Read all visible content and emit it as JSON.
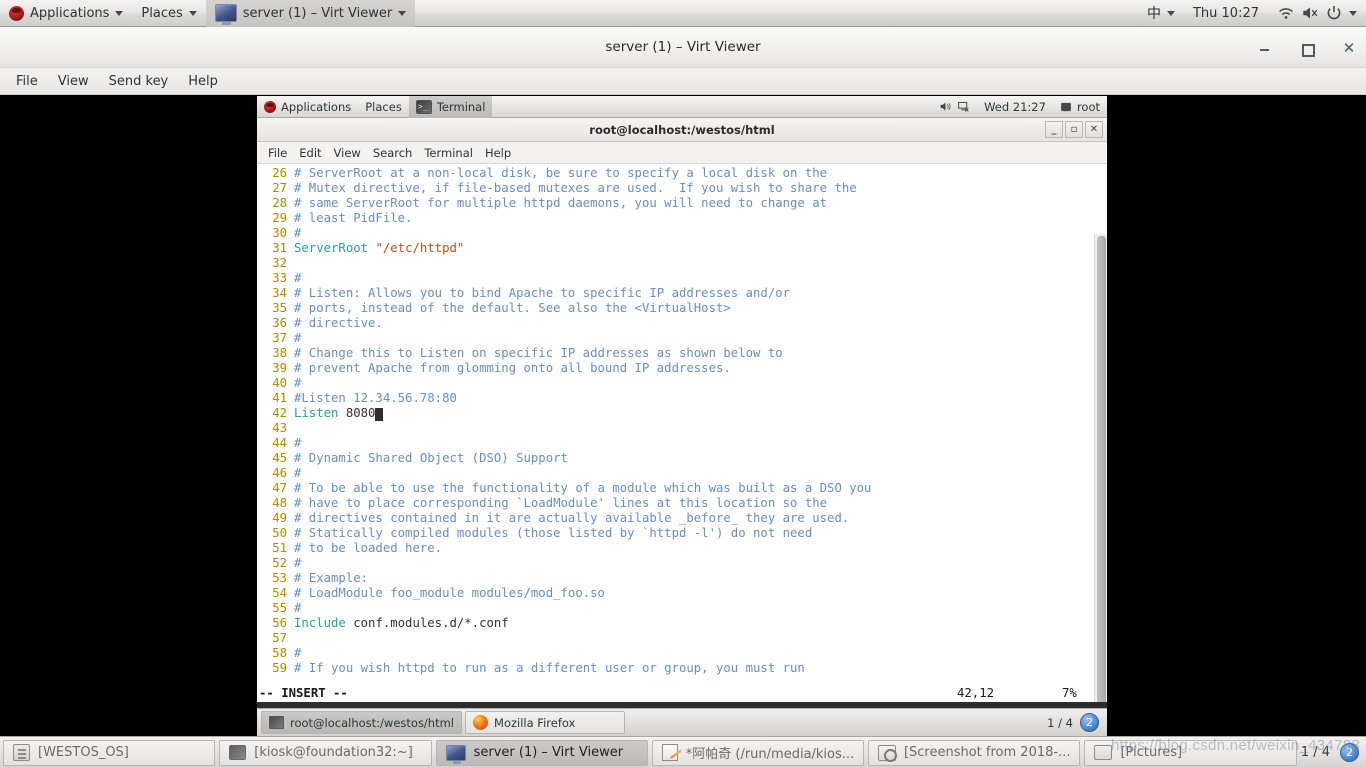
{
  "host_topbar": {
    "applications": "Applications",
    "places": "Places",
    "window_title": "server (1) – Virt Viewer",
    "ime": "中",
    "clock": "Thu 10:27",
    "icons": [
      "redhat-logo",
      "wifi-icon",
      "volume-muted-icon",
      "power-icon",
      "chevron-down-icon"
    ]
  },
  "virt_viewer": {
    "title": "server (1) – Virt Viewer",
    "menus": [
      "File",
      "View",
      "Send key",
      "Help"
    ],
    "window_buttons": [
      "minimize",
      "maximize",
      "close"
    ]
  },
  "guest": {
    "topbar": {
      "applications": "Applications",
      "places": "Places",
      "active_window": "Terminal",
      "clock": "Wed 21:27",
      "user": "root"
    },
    "terminal": {
      "title": "root@localhost:/westos/html",
      "menus": [
        "File",
        "Edit",
        "View",
        "Search",
        "Terminal",
        "Help"
      ],
      "status": {
        "mode": "-- INSERT --",
        "position": "42,12",
        "percent": "7%"
      },
      "lines": [
        {
          "n": "26",
          "cmt": "# ServerRoot at a non-local disk, be sure to specify a local disk on the"
        },
        {
          "n": "27",
          "cmt": "# Mutex directive, if file-based mutexes are used.  If you wish to share the"
        },
        {
          "n": "28",
          "cmt": "# same ServerRoot for multiple httpd daemons, you will need to change at"
        },
        {
          "n": "29",
          "cmt": "# least PidFile."
        },
        {
          "n": "30",
          "cmt": "#"
        },
        {
          "n": "31",
          "dir": "ServerRoot",
          "str": " \"/etc/httpd\""
        },
        {
          "n": "32",
          "cmt": ""
        },
        {
          "n": "33",
          "cmt": "#"
        },
        {
          "n": "34",
          "cmt": "# Listen: Allows you to bind Apache to specific IP addresses and/or"
        },
        {
          "n": "35",
          "cmt": "# ports, instead of the default. See also the <VirtualHost>"
        },
        {
          "n": "36",
          "cmt": "# directive."
        },
        {
          "n": "37",
          "cmt": "#"
        },
        {
          "n": "38",
          "cmt": "# Change this to Listen on specific IP addresses as shown below to"
        },
        {
          "n": "39",
          "cmt": "# prevent Apache from glomming onto all bound IP addresses."
        },
        {
          "n": "40",
          "cmt": "#"
        },
        {
          "n": "41",
          "cmt": "#Listen 12.34.56.78:80"
        },
        {
          "n": "42",
          "dir": "Listen",
          "val": " 8080",
          "cursor": true
        },
        {
          "n": "43",
          "cmt": ""
        },
        {
          "n": "44",
          "cmt": "#"
        },
        {
          "n": "45",
          "cmt": "# Dynamic Shared Object (DSO) Support"
        },
        {
          "n": "46",
          "cmt": "#"
        },
        {
          "n": "47",
          "cmt": "# To be able to use the functionality of a module which was built as a DSO you"
        },
        {
          "n": "48",
          "cmt": "# have to place corresponding `LoadModule' lines at this location so the"
        },
        {
          "n": "49",
          "cmt": "# directives contained in it are actually available _before_ they are used."
        },
        {
          "n": "50",
          "cmt": "# Statically compiled modules (those listed by `httpd -l') do not need"
        },
        {
          "n": "51",
          "cmt": "# to be loaded here."
        },
        {
          "n": "52",
          "cmt": "#"
        },
        {
          "n": "53",
          "cmt": "# Example:"
        },
        {
          "n": "54",
          "cmt": "# LoadModule foo_module modules/mod_foo.so"
        },
        {
          "n": "55",
          "cmt": "#"
        },
        {
          "n": "56",
          "dir": "Include",
          "val": " conf.modules.d/*.conf"
        },
        {
          "n": "57",
          "cmt": ""
        },
        {
          "n": "58",
          "cmt": "#"
        },
        {
          "n": "59",
          "cmt": "# If you wish httpd to run as a different user or group, you must run"
        }
      ]
    },
    "taskbar": {
      "items": [
        {
          "label": "root@localhost:/westos/html",
          "icon": "terminal-icon",
          "active": true
        },
        {
          "label": "Mozilla Firefox",
          "icon": "firefox-icon",
          "active": false
        }
      ],
      "workspace_count": "1 / 4",
      "workspace_badge": "2"
    }
  },
  "host_taskbar": {
    "items": [
      {
        "label": "[WESTOS_OS]",
        "icon": "archive-icon",
        "active": false
      },
      {
        "label": "[kiosk@foundation32:~]",
        "icon": "terminal-icon",
        "active": false
      },
      {
        "label": "server (1) – Virt Viewer",
        "icon": "monitor-icon",
        "active": true
      },
      {
        "label": "*阿帕奇 (/run/media/kios...",
        "icon": "notepad-icon",
        "active": false
      },
      {
        "label": "[Screenshot from 2018-...",
        "icon": "image-viewer-icon",
        "active": false
      },
      {
        "label": "[Pictures]",
        "icon": "folder-icon",
        "active": false
      }
    ],
    "workspace_count": "1 / 4",
    "workspace_badge": "2"
  },
  "watermark": "https://blog.csdn.net/weixin_434788",
  "colors": {
    "line_number": "#b58900",
    "comment": "#6c8ebf",
    "directive": "#2aa198",
    "string": "#cb4b16",
    "terminal_bg": "#ffffff"
  }
}
